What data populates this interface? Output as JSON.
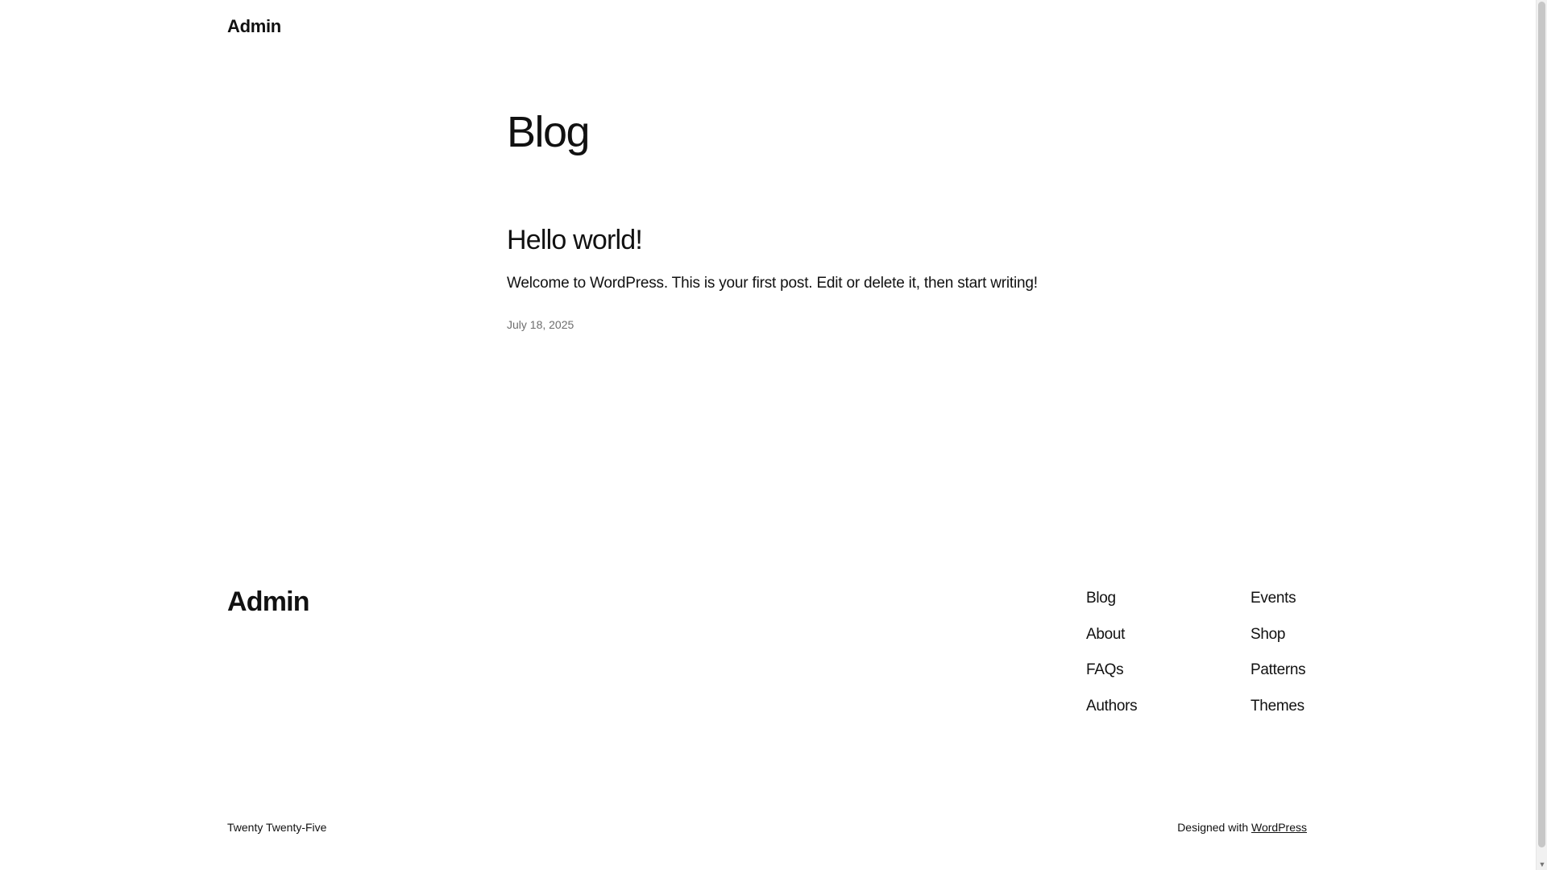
{
  "header": {
    "site_title": "Admin"
  },
  "main": {
    "page_title": "Blog",
    "posts": [
      {
        "title": "Hello world!",
        "excerpt": "Welcome to WordPress. This is your first post. Edit or delete it, then start writing!",
        "date": "July 18, 2025"
      }
    ]
  },
  "footer": {
    "site_title": "Admin",
    "nav_col_1": [
      "Blog",
      "About",
      "FAQs",
      "Authors"
    ],
    "nav_col_2": [
      "Events",
      "Shop",
      "Patterns",
      "Themes"
    ],
    "credit": "Twenty Twenty-Five",
    "designed_with_prefix": "Designed with",
    "designed_with_link": "WordPress"
  },
  "scrollbar": {
    "down_arrow": "▼"
  }
}
